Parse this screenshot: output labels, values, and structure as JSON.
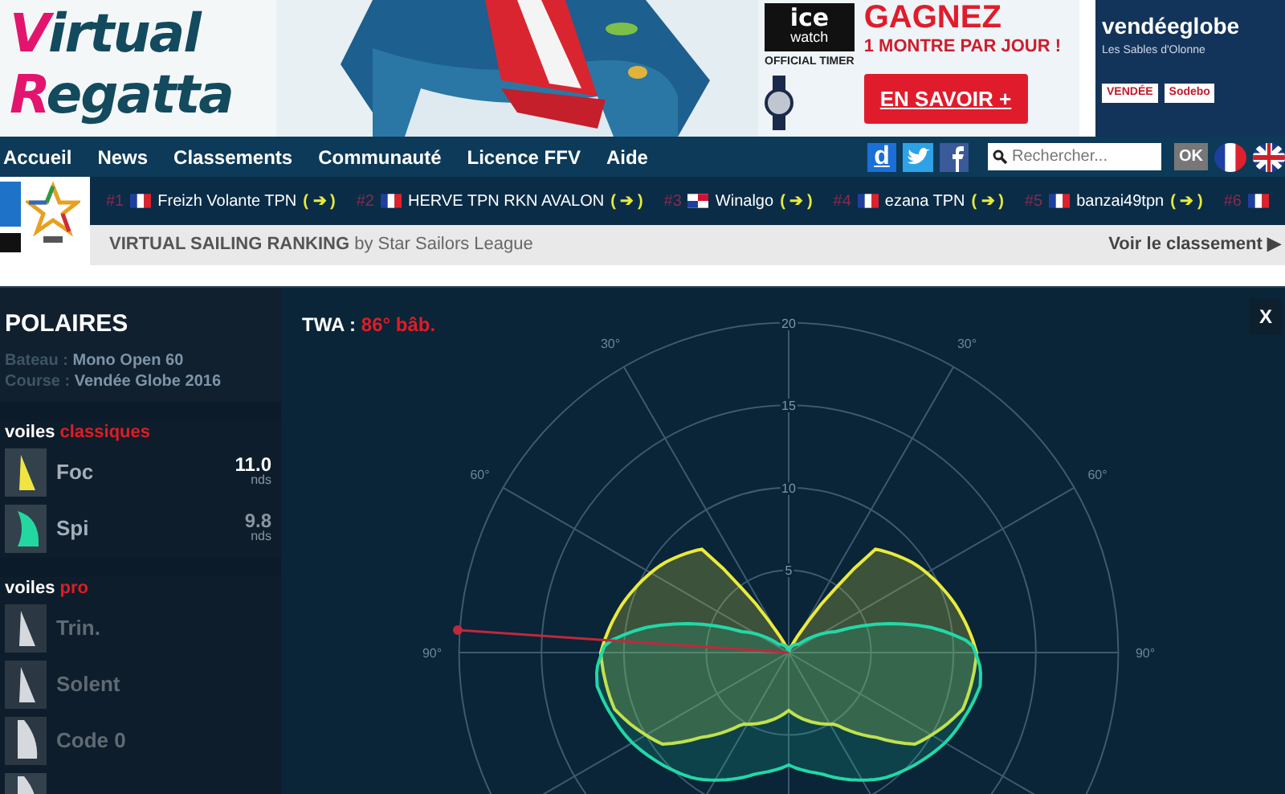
{
  "banner": {
    "logo": [
      {
        "initial": "V",
        "rest": "irtual"
      },
      {
        "initial": "R",
        "rest": "egatta"
      }
    ],
    "ad": {
      "brand": "ice",
      "brand_sub": "watch",
      "brand_tag": "OFFICIAL TIMER",
      "headline": "GAGNEZ",
      "subline": "1 MONTRE PAR JOUR !",
      "cta": "EN SAVOIR +"
    },
    "partner": {
      "name": "vendéeglobe",
      "place": "Les Sables d'Olonne",
      "sponsors": [
        "VENDÉE",
        "Sodebo"
      ]
    }
  },
  "nav": {
    "items": [
      "Accueil",
      "News",
      "Classements",
      "Communauté",
      "Licence FFV",
      "Aide"
    ],
    "social_letter": "d",
    "search": {
      "placeholder": "Rechercher..."
    },
    "ok": "OK",
    "flags": [
      {
        "kind": "fr"
      },
      {
        "kind": "uk"
      }
    ]
  },
  "ranking": {
    "items": [
      {
        "rank": "#1",
        "flag": {
          "kind": "fr"
        },
        "name": "Freizh Volante TPN",
        "go": "( ➔ )"
      },
      {
        "rank": "#2",
        "flag": {
          "kind": "fr"
        },
        "name": "HERVE TPN RKN AVALON",
        "go": "( ➔ )"
      },
      {
        "rank": "#3",
        "flag": {
          "kind": "pa"
        },
        "name": "Winalgo",
        "go": "( ➔ )"
      },
      {
        "rank": "#4",
        "flag": {
          "kind": "fr"
        },
        "name": "ezana TPN",
        "go": "( ➔ )"
      },
      {
        "rank": "#5",
        "flag": {
          "kind": "fr"
        },
        "name": "banzai49tpn",
        "go": "( ➔ )"
      },
      {
        "rank": "#6",
        "flag": {
          "kind": "fr"
        }
      }
    ],
    "title": "**VIRTUAL SAILING RANKING** by Star Sailors League",
    "more": "Voir le classement ▶"
  },
  "polars": {
    "title": "POLAIRES",
    "details": [
      {
        "label": "Bateau :",
        "value": "Mono Open 60"
      },
      {
        "label": "Course :",
        "value": "Vendée Globe 2016"
      }
    ],
    "groups": [
      {
        "label": "voiles",
        "accent": "classiques",
        "sails": [
          {
            "kind": "jib",
            "name": "Foc",
            "speed": "11.0",
            "unit": "nds",
            "color": "#f0e442",
            "best": true,
            "disabled": false
          },
          {
            "kind": "spi",
            "name": "Spi",
            "speed": "9.8",
            "unit": "nds",
            "color": "#22d8a0",
            "best": false,
            "disabled": false
          }
        ]
      },
      {
        "label": "voiles",
        "accent": "pro",
        "sails": [
          {
            "kind": "jib",
            "name": "Trin.",
            "color": "#d5d9de",
            "disabled": true
          },
          {
            "kind": "jib",
            "name": "Solent",
            "color": "#d5d9de",
            "disabled": true
          },
          {
            "kind": "code",
            "name": "Code 0",
            "color": "#d5d9de",
            "disabled": true
          },
          {
            "kind": "code",
            "color": "#d5d9de"
          }
        ]
      }
    ]
  },
  "chart": {
    "twa_label": "TWA :",
    "twa_value": "86° bâb.",
    "close": "X",
    "rings": [
      "20",
      "15",
      "10",
      "5"
    ],
    "port_labels": [
      "30°",
      "60°",
      "90°"
    ],
    "starboard_labels": [
      "30°",
      "60°",
      "90°"
    ]
  }
}
